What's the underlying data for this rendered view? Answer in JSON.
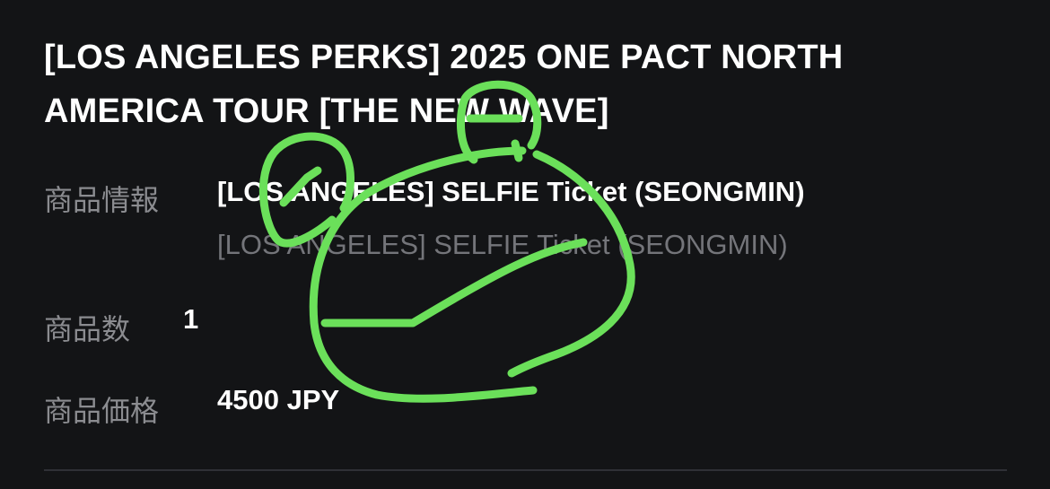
{
  "product": {
    "title": "[LOS ANGELES PERKS] 2025 ONE PACT NORTH AMERICA TOUR [THE NEW WAVE]"
  },
  "details": {
    "info_label": "商品情報",
    "info_value": "[LOS ANGELES] SELFIE Ticket (SEONGMIN)",
    "info_sub_value": "[LOS ANGELES] SELFIE Ticket (SEONGMIN)",
    "quantity_label": "商品数",
    "quantity_value": "1",
    "price_label": "商品価格",
    "price_value": "4500 JPY"
  },
  "colors": {
    "background": "#131416",
    "label": "#8b8c90",
    "sub_text": "#74757a",
    "scribble": "#6be05a"
  }
}
